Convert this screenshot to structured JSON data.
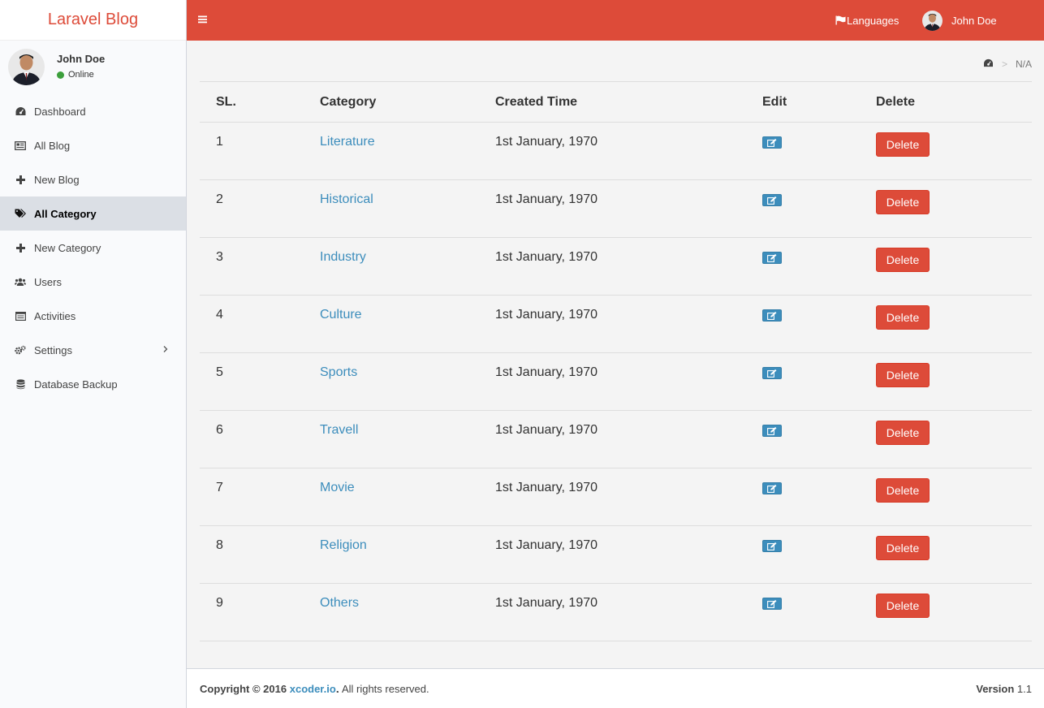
{
  "app": {
    "logo": "Laravel Blog"
  },
  "user": {
    "name": "John Doe",
    "status": "Online"
  },
  "sidebar": {
    "items": [
      {
        "label": "Dashboard",
        "icon": "dashboard-icon"
      },
      {
        "label": "All Blog",
        "icon": "newspaper-icon"
      },
      {
        "label": "New Blog",
        "icon": "plus-icon"
      },
      {
        "label": "All Category",
        "icon": "tags-icon",
        "active": true
      },
      {
        "label": "New Category",
        "icon": "plus-icon"
      },
      {
        "label": "Users",
        "icon": "users-icon"
      },
      {
        "label": "Activities",
        "icon": "list-icon"
      },
      {
        "label": "Settings",
        "icon": "cogs-icon",
        "has_submenu": true
      },
      {
        "label": "Database Backup",
        "icon": "database-icon"
      }
    ]
  },
  "header": {
    "languages_label": "Languages",
    "user_name": "John Doe",
    "accent": "#dd4b39"
  },
  "breadcrumb": {
    "current": "N/A"
  },
  "table": {
    "columns": [
      "SL.",
      "Category",
      "Created Time",
      "Edit",
      "Delete"
    ],
    "delete_label": "Delete",
    "rows": [
      {
        "sl": "1",
        "category": "Literature",
        "created": "1st January, 1970"
      },
      {
        "sl": "2",
        "category": "Historical",
        "created": "1st January, 1970"
      },
      {
        "sl": "3",
        "category": "Industry",
        "created": "1st January, 1970"
      },
      {
        "sl": "4",
        "category": "Culture",
        "created": "1st January, 1970"
      },
      {
        "sl": "5",
        "category": "Sports",
        "created": "1st January, 1970"
      },
      {
        "sl": "6",
        "category": "Travell",
        "created": "1st January, 1970"
      },
      {
        "sl": "7",
        "category": "Movie",
        "created": "1st January, 1970"
      },
      {
        "sl": "8",
        "category": "Religion",
        "created": "1st January, 1970"
      },
      {
        "sl": "9",
        "category": "Others",
        "created": "1st January, 1970"
      }
    ]
  },
  "footer": {
    "copyright_prefix": "Copyright © 2016",
    "company": "xcoder.io",
    "suffix": ". All rights reserved.",
    "version_label": "Version",
    "version": "1.1"
  }
}
